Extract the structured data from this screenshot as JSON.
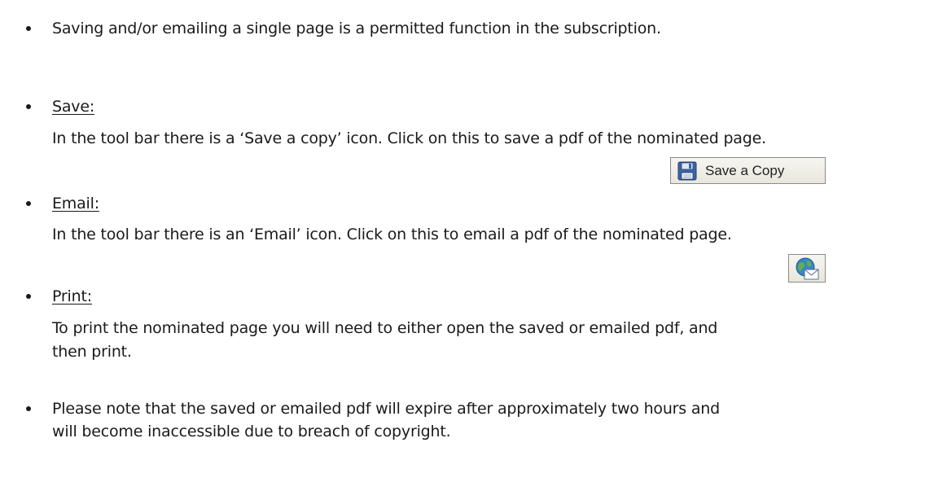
{
  "items": [
    {
      "text": "Saving and/or emailing a single page is a permitted function in the subscription."
    },
    {
      "heading": "Save:",
      "text": "In the tool bar there is a ‘Save a copy’ icon. Click on this to save a pdf of the nominated page."
    },
    {
      "heading": "Email:",
      "text": "In the tool bar there is an ‘Email’ icon. Click on this to email a pdf of the nominated page."
    },
    {
      "heading": "Print:",
      "text_line1": "To print the nominated page you will need to either open the saved or emailed pdf, and",
      "text_line2": "then print."
    },
    {
      "text_line1": "Please note that the saved or emailed pdf will expire after approximately two hours and",
      "text_line2": "will become inaccessible due to breach of copyright."
    }
  ],
  "toolbar": {
    "save_copy_label": "Save a Copy",
    "save_icon": "floppy-disk-icon",
    "email_icon": "globe-envelope-icon"
  }
}
